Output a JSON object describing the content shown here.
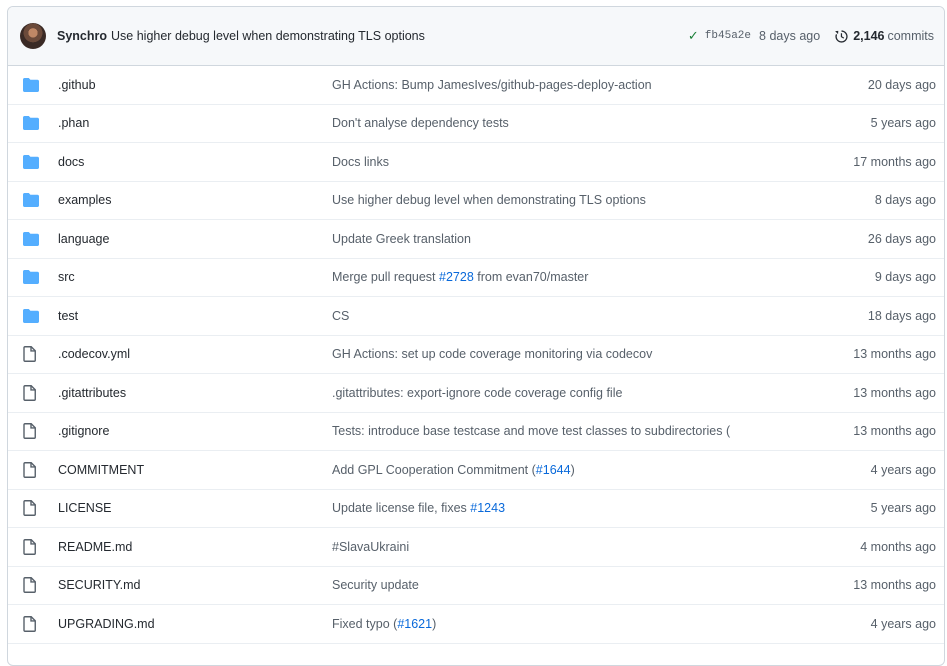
{
  "latest_commit": {
    "author": "Synchro",
    "message": "Use higher debug level when demonstrating TLS options",
    "sha": "fb45a2e",
    "ago": "8 days ago",
    "commits_count": "2,146",
    "commits_label": "commits",
    "status_icon": "check-icon",
    "history_icon": "history-icon"
  },
  "files": [
    {
      "type": "dir",
      "icon": "folder-icon",
      "name": ".github",
      "message": "GH Actions: Bump JamesIves/github-pages-deploy-action",
      "age": "20 days ago"
    },
    {
      "type": "dir",
      "icon": "folder-icon",
      "name": ".phan",
      "message": "Don't analyse dependency tests",
      "age": "5 years ago"
    },
    {
      "type": "dir",
      "icon": "folder-icon",
      "name": "docs",
      "message": "Docs links",
      "age": "17 months ago"
    },
    {
      "type": "dir",
      "icon": "folder-icon",
      "name": "examples",
      "message": "Use higher debug level when demonstrating TLS options",
      "age": "8 days ago"
    },
    {
      "type": "dir",
      "icon": "folder-icon",
      "name": "language",
      "message": "Update Greek translation",
      "age": "26 days ago"
    },
    {
      "type": "dir",
      "icon": "folder-icon",
      "name": "src",
      "message": "Merge pull request ",
      "link": "#2728",
      "message_after": " from evan70/master",
      "age": "9 days ago"
    },
    {
      "type": "dir",
      "icon": "folder-icon",
      "name": "test",
      "message": "CS",
      "age": "18 days ago"
    },
    {
      "type": "file",
      "icon": "file-icon",
      "name": ".codecov.yml",
      "message": "GH Actions: set up code coverage monitoring via codecov",
      "age": "13 months ago"
    },
    {
      "type": "file",
      "icon": "file-icon",
      "name": ".gitattributes",
      "message": ".gitattributes: export-ignore code coverage config file",
      "age": "13 months ago"
    },
    {
      "type": "file",
      "icon": "file-icon",
      "name": ".gitignore",
      "message": "Tests: introduce base testcase and move test classes to subdirectories (",
      "age": "13 months ago"
    },
    {
      "type": "file",
      "icon": "file-icon",
      "name": "COMMITMENT",
      "message": "Add GPL Cooperation Commitment (",
      "link": "#1644",
      "message_after": ")",
      "age": "4 years ago"
    },
    {
      "type": "file",
      "icon": "file-icon",
      "name": "LICENSE",
      "message": "Update license file, fixes ",
      "link": "#1243",
      "message_after": "",
      "age": "5 years ago"
    },
    {
      "type": "file",
      "icon": "file-icon",
      "name": "README.md",
      "message": "#SlavaUkraini",
      "age": "4 months ago"
    },
    {
      "type": "file",
      "icon": "file-icon",
      "name": "SECURITY.md",
      "message": "Security update",
      "age": "13 months ago"
    },
    {
      "type": "file",
      "icon": "file-icon",
      "name": "UPGRADING.md",
      "message": "Fixed typo (",
      "link": "#1621",
      "message_after": ")",
      "age": "4 years ago"
    }
  ]
}
